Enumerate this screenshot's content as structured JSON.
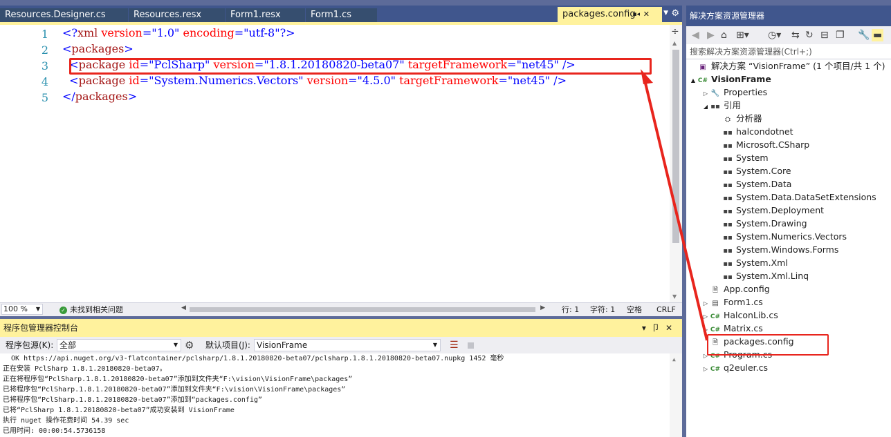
{
  "tabs": [
    {
      "label": "Resources.Designer.cs",
      "active": false
    },
    {
      "label": "Resources.resx",
      "active": false
    },
    {
      "label": "Form1.resx",
      "active": false
    },
    {
      "label": "Form1.cs",
      "active": false
    },
    {
      "label": "packages.config",
      "active": true
    }
  ],
  "tab_icons": {
    "pin": "pin-icon",
    "close": "close-icon",
    "overflow": "chevron-down-icon",
    "settings": "gear-icon"
  },
  "editor": {
    "line_numbers": [
      "1",
      "2",
      "3",
      "4",
      "5"
    ],
    "lines": [
      {
        "indent": "",
        "open": "<?",
        "tag": "xml",
        "attrs": [
          {
            "name": "version",
            "value": "\"1.0\""
          },
          {
            "name": "encoding",
            "value": "\"utf-8\""
          }
        ],
        "close": "?>"
      },
      {
        "indent": "",
        "open": "<",
        "tag": "packages",
        "attrs": [],
        "close": ">"
      },
      {
        "indent": "  ",
        "open": "<",
        "tag": "package",
        "attrs": [
          {
            "name": "id",
            "value": "\"PclSharp\""
          },
          {
            "name": "version",
            "value": "\"1.8.1.20180820-beta07\""
          },
          {
            "name": "targetFramework",
            "value": "\"net45\""
          }
        ],
        "close": " />"
      },
      {
        "indent": "  ",
        "open": "<",
        "tag": "package",
        "attrs": [
          {
            "name": "id",
            "value": "\"System.Numerics.Vectors\""
          },
          {
            "name": "version",
            "value": "\"4.5.0\""
          },
          {
            "name": "targetFramework",
            "value": "\"net45\""
          }
        ],
        "close": " />"
      },
      {
        "indent": "",
        "open": "</",
        "tag": "packages",
        "attrs": [],
        "close": ">"
      }
    ]
  },
  "editor_status": {
    "zoom": "100 %",
    "issues": "未找到相关问题",
    "line": "行: 1",
    "char": "字符: 1",
    "whitespace": "空格",
    "eol": "CRLF"
  },
  "pmc": {
    "title": "程序包管理器控制台",
    "source_label": "程序包源(K):",
    "source_value": "全部",
    "project_label": "默认项目(J):",
    "project_value": "VisionFrame",
    "output": [
      "  OK https://api.nuget.org/v3-flatcontainer/pclsharp/1.8.1.20180820-beta07/pclsharp.1.8.1.20180820-beta07.nupkg 1452 毫秒",
      "正在安装 PclSharp 1.8.1.20180820-beta07。",
      "正在将程序包“PclSharp.1.8.1.20180820-beta07”添加到文件夹“F:\\vision\\VisionFrame\\packages”",
      "已将程序包“PclSharp.1.8.1.20180820-beta07”添加到文件夹“F:\\vision\\VisionFrame\\packages”",
      "已将程序包“PclSharp.1.8.1.20180820-beta07”添加到“packages.config”",
      "已将“PclSharp 1.8.1.20180820-beta07”成功安装到 VisionFrame",
      "执行 nuget 操作花费时间 54.39 sec",
      "已用时间: 00:00:54.5736158"
    ]
  },
  "solution_explorer": {
    "title": "解决方案资源管理器",
    "search_placeholder": "搜索解决方案资源管理器(Ctrl+;)",
    "tree": [
      {
        "label": "解决方案 “VisionFrame” (1 个项目/共 1 个)",
        "level": 0,
        "arrow": "",
        "icon": "solution-icon",
        "bold": false
      },
      {
        "label": "VisionFrame",
        "level": 0,
        "arrow": "▲",
        "icon": "csharp-project-icon",
        "bold": true
      },
      {
        "label": "Properties",
        "level": 1,
        "arrow": "▷",
        "icon": "wrench-icon",
        "bold": false
      },
      {
        "label": "引用",
        "level": 1,
        "arrow": "◢",
        "icon": "references-icon",
        "bold": false
      },
      {
        "label": "分析器",
        "level": 2,
        "arrow": "",
        "icon": "analyzer-icon",
        "bold": false
      },
      {
        "label": "halcondotnet",
        "level": 2,
        "arrow": "",
        "icon": "reference-icon",
        "bold": false
      },
      {
        "label": "Microsoft.CSharp",
        "level": 2,
        "arrow": "",
        "icon": "reference-icon",
        "bold": false
      },
      {
        "label": "System",
        "level": 2,
        "arrow": "",
        "icon": "reference-icon",
        "bold": false
      },
      {
        "label": "System.Core",
        "level": 2,
        "arrow": "",
        "icon": "reference-icon",
        "bold": false
      },
      {
        "label": "System.Data",
        "level": 2,
        "arrow": "",
        "icon": "reference-icon",
        "bold": false
      },
      {
        "label": "System.Data.DataSetExtensions",
        "level": 2,
        "arrow": "",
        "icon": "reference-icon",
        "bold": false
      },
      {
        "label": "System.Deployment",
        "level": 2,
        "arrow": "",
        "icon": "reference-icon",
        "bold": false
      },
      {
        "label": "System.Drawing",
        "level": 2,
        "arrow": "",
        "icon": "reference-icon",
        "bold": false
      },
      {
        "label": "System.Numerics.Vectors",
        "level": 2,
        "arrow": "",
        "icon": "reference-icon",
        "bold": false
      },
      {
        "label": "System.Windows.Forms",
        "level": 2,
        "arrow": "",
        "icon": "reference-icon",
        "bold": false
      },
      {
        "label": "System.Xml",
        "level": 2,
        "arrow": "",
        "icon": "reference-icon",
        "bold": false
      },
      {
        "label": "System.Xml.Linq",
        "level": 2,
        "arrow": "",
        "icon": "reference-icon",
        "bold": false
      },
      {
        "label": "App.config",
        "level": 1,
        "arrow": "",
        "icon": "config-file-icon",
        "bold": false
      },
      {
        "label": "Form1.cs",
        "level": 1,
        "arrow": "▷",
        "icon": "form-icon",
        "bold": false
      },
      {
        "label": "HalconLib.cs",
        "level": 1,
        "arrow": "▷",
        "icon": "csharp-file-icon",
        "bold": false
      },
      {
        "label": "Matrix.cs",
        "level": 1,
        "arrow": "▷",
        "icon": "csharp-file-icon",
        "bold": false
      },
      {
        "label": "packages.config",
        "level": 1,
        "arrow": "",
        "icon": "config-file-icon",
        "bold": false
      },
      {
        "label": "Program.cs",
        "level": 1,
        "arrow": "▷",
        "icon": "csharp-file-icon",
        "bold": false
      },
      {
        "label": "q2euler.cs",
        "level": 1,
        "arrow": "▷",
        "icon": "csharp-file-icon",
        "bold": false
      }
    ]
  },
  "colors": {
    "accent_yellow": "#fff29d",
    "title_blue": "#40568d",
    "annotation_red": "#e8251d",
    "xml_tag": "#a31515",
    "xml_attr": "#ff0000",
    "xml_value": "#0000ff",
    "line_number": "#2b91af"
  }
}
